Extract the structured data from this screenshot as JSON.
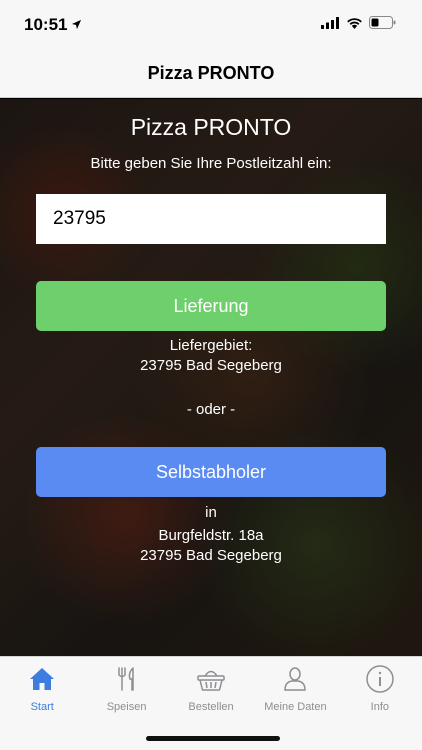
{
  "status_bar": {
    "time": "10:51",
    "icons": [
      "location-arrow-icon",
      "cellular-signal-icon",
      "wifi-icon",
      "battery-icon"
    ]
  },
  "nav": {
    "title": "Pizza PRONTO"
  },
  "main": {
    "title": "Pizza PRONTO",
    "prompt": "Bitte geben Sie Ihre Postleitzahl ein:",
    "zip_value": "23795",
    "delivery_button": "Lieferung",
    "delivery_area_label": "Liefergebiet:",
    "delivery_area_value": "23795 Bad Segeberg",
    "or_label": "- oder -",
    "pickup_button": "Selbstabholer",
    "in_label": "in",
    "address_street": "Burgfeldstr. 18a",
    "address_city": "23795 Bad Segeberg"
  },
  "tabs": [
    {
      "label": "Start",
      "icon": "home-icon",
      "active": true
    },
    {
      "label": "Speisen",
      "icon": "cutlery-icon",
      "active": false
    },
    {
      "label": "Bestellen",
      "icon": "basket-icon",
      "active": false
    },
    {
      "label": "Meine Daten",
      "icon": "person-icon",
      "active": false
    },
    {
      "label": "Info",
      "icon": "info-icon",
      "active": false
    }
  ],
  "colors": {
    "delivery_button": "#6dd06d",
    "pickup_button": "#5a8bf3",
    "active_tab": "#3d7de0",
    "inactive_tab": "#8e8e93"
  }
}
